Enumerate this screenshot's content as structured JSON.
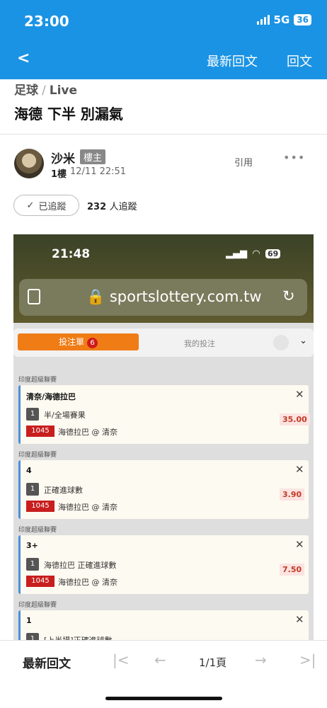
{
  "status_bar": {
    "time": "23:00",
    "network": "5G",
    "battery": "36"
  },
  "nav": {
    "back_icon": "chevron-left-icon",
    "latest_replies": "最新回文",
    "reply": "回文"
  },
  "breadcrumb": {
    "category": "足球",
    "separator": "/",
    "sub": "Live"
  },
  "post": {
    "title": "海德 下半 別漏氣",
    "author": "沙米",
    "host_badge": "樓主",
    "floor": "1樓",
    "datetime": "12/11 22:51",
    "quote": "引用",
    "more": "•••",
    "follow_label": "已追蹤",
    "follow_count": "232",
    "follow_unit": "人追蹤"
  },
  "screenshot": {
    "time": "21:48",
    "battery": "69",
    "url": "sportslottery.com.tw",
    "tab_active": "投注單",
    "tab_count": "6",
    "tab_other": "我的投注",
    "bets": [
      {
        "league": "印度超級聯賽",
        "pick": "清奈/海德拉巴",
        "num": "1",
        "market": "半/全場賽果",
        "code": "1045",
        "match": "海德拉巴 @ 清奈",
        "odds": "35.00"
      },
      {
        "league": "印度超級聯賽",
        "pick": "4",
        "num": "1",
        "market": "正確進球數",
        "code": "1045",
        "match": "海德拉巴 @ 清奈",
        "odds": "3.90"
      },
      {
        "league": "印度超級聯賽",
        "pick": "3+",
        "num": "1",
        "market": "海德拉巴 正確進球數",
        "code": "1045",
        "match": "海德拉巴 @ 清奈",
        "odds": "7.50"
      },
      {
        "league": "印度超級聯賽",
        "pick": "1",
        "num": "1",
        "market": "[上半場]正確進球數",
        "code": "",
        "match": "",
        "odds": ""
      }
    ]
  },
  "bottom": {
    "latest_replies": "最新回文",
    "page": "1/1頁"
  },
  "colors": {
    "brand": "#1a93e4",
    "accent_orange": "#f07c16",
    "code_red": "#c81e1e"
  }
}
